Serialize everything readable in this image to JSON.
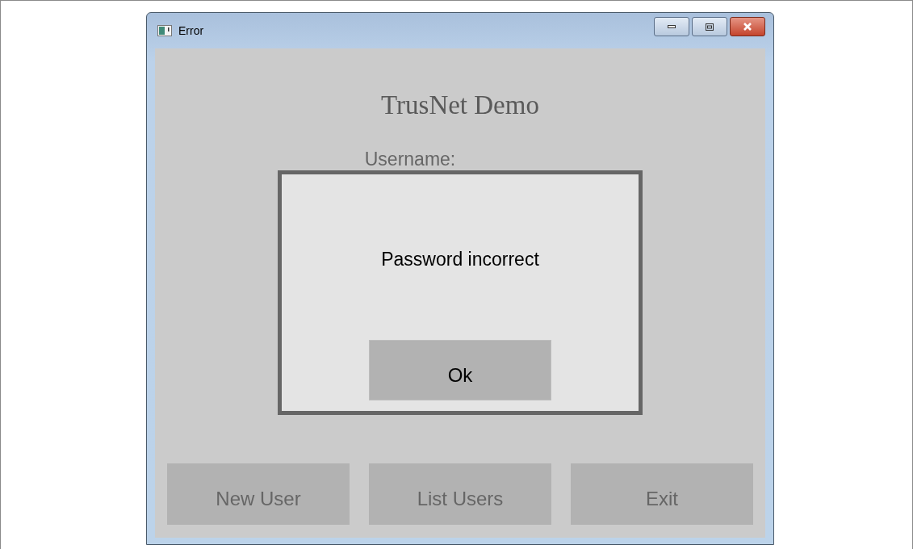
{
  "window": {
    "title": "Error"
  },
  "app": {
    "title": "TrusNet Demo",
    "username_label": "Username:"
  },
  "dialog": {
    "message": "Password incorrect",
    "button": "Ok"
  },
  "buttons": [
    "New User",
    "List Users",
    "Exit"
  ]
}
